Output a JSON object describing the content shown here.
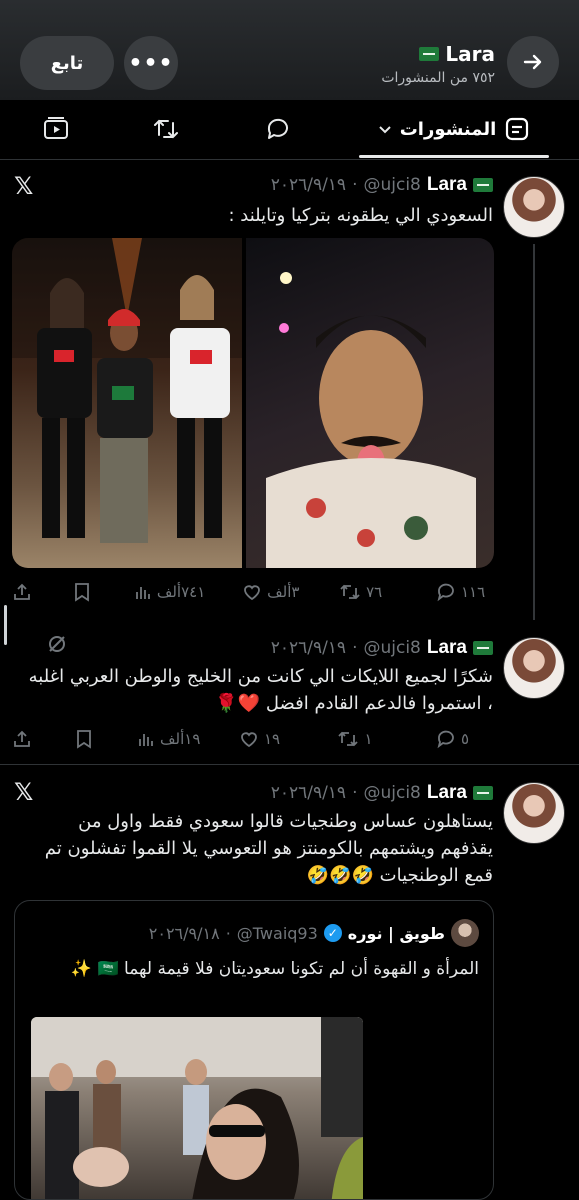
{
  "header": {
    "name": "Lara",
    "posts_count": "٧٥٢ من المنشورات",
    "follow_label": "تابع",
    "more_label": "•••"
  },
  "tabs": {
    "posts_label": "المنشورات"
  },
  "tweets": [
    {
      "name": "Lara",
      "handle": "@ujci8",
      "date": "٢٠٢٦/٩/١٩",
      "text": "السعودي الي يطقونه بتركيا وتايلند :",
      "replies": "١١٦",
      "reposts": "٧٦",
      "likes": "٣ألف",
      "views": "٧٤١ألف"
    },
    {
      "name": "Lara",
      "handle": "@ujci8",
      "date": "٢٠٢٦/٩/١٩",
      "text": "شكرًا لجميع اللايكات الي كانت من الخليج والوطن العربي اغلبه ، استمروا فالدعم القادم افضل ❤️🌹",
      "replies": "٥",
      "reposts": "١",
      "likes": "١٩",
      "views": "١٩ألف"
    },
    {
      "name": "Lara",
      "handle": "@ujci8",
      "date": "٢٠٢٦/٩/١٩",
      "text": "يستاهلون عساس وطنجيات قالوا سعودي فقط واول من يقذفهم ويشتمهم بالكومنتز هو التعوسي يلا القموا تفشلون تم قمع الوطنجيات 🤣🤣🤣",
      "quote": {
        "name": "طويق | نوره",
        "handle": "@Twaiq93",
        "date": "٢٠٢٦/٩/١٨",
        "text": "المرأة و القهوة أن لم تكونا سعوديتان فلا قيمة لهما 🇸🇦 ✨"
      }
    }
  ]
}
